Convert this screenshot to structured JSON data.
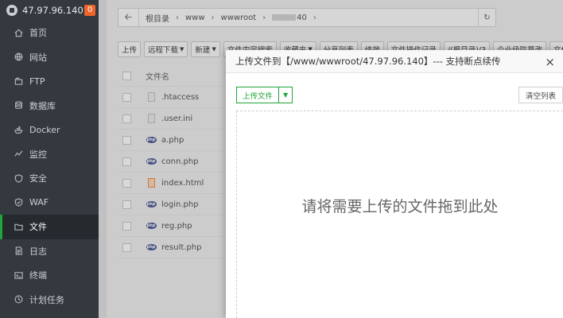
{
  "sidebar": {
    "server_ip": "47.97.96.140",
    "badge": "0",
    "items": [
      {
        "label": "首页",
        "icon": "home-icon"
      },
      {
        "label": "网站",
        "icon": "globe-icon"
      },
      {
        "label": "FTP",
        "icon": "ftp-icon"
      },
      {
        "label": "数据库",
        "icon": "database-icon"
      },
      {
        "label": "Docker",
        "icon": "docker-icon"
      },
      {
        "label": "监控",
        "icon": "monitor-icon"
      },
      {
        "label": "安全",
        "icon": "shield-icon"
      },
      {
        "label": "WAF",
        "icon": "waf-icon"
      },
      {
        "label": "文件",
        "icon": "folder-icon",
        "active": true
      },
      {
        "label": "日志",
        "icon": "log-icon"
      },
      {
        "label": "终端",
        "icon": "terminal-icon"
      },
      {
        "label": "计划任务",
        "icon": "clock-icon"
      }
    ]
  },
  "path": {
    "crumbs": [
      "根目录",
      "www",
      "wwwroot",
      "40"
    ]
  },
  "toolbar": {
    "buttons": [
      "上传",
      "远程下载",
      "新建",
      "文件内容搜索",
      "收藏夹",
      "分享列表",
      "终端",
      "文件操作记录",
      "/(根目录)/3",
      "企业级防篡改",
      "文件同步"
    ]
  },
  "table": {
    "header": "文件名",
    "files": [
      {
        "name": ".htaccess",
        "type": "doc"
      },
      {
        "name": ".user.ini",
        "type": "doc"
      },
      {
        "name": "a.php",
        "type": "php"
      },
      {
        "name": "conn.php",
        "type": "php"
      },
      {
        "name": "index.html",
        "type": "html"
      },
      {
        "name": "login.php",
        "type": "php"
      },
      {
        "name": "reg.php",
        "type": "php"
      },
      {
        "name": "result.php",
        "type": "php"
      }
    ]
  },
  "modal": {
    "title": "上传文件到【/www/wwwroot/47.97.96.140】--- 支持断点续传",
    "close": "×",
    "upload_label": "上传文件",
    "clear_label": "清空列表",
    "drop_text": "请将需要上传的文件拖到此处"
  }
}
